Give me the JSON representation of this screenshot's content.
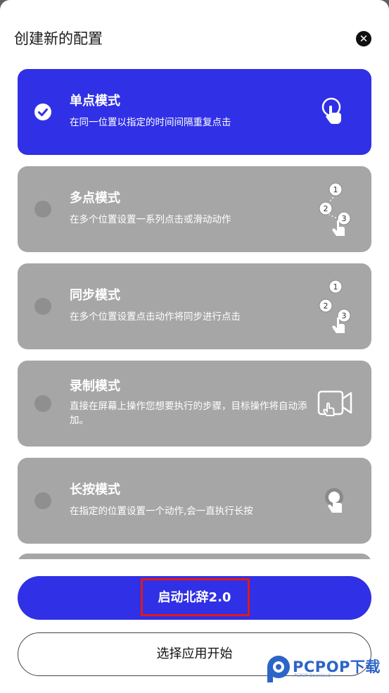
{
  "dialog": {
    "title": "创建新的配置",
    "close_icon": "close-icon"
  },
  "modes": [
    {
      "name": "单点模式",
      "description": "在同一位置以指定的时间间隔重复点击",
      "selected": true,
      "icon": "single-tap-icon"
    },
    {
      "name": "多点模式",
      "description": "在多个位置设置一系列点击或滑动动作",
      "selected": false,
      "icon": "multi-tap-icon",
      "steps": [
        "1",
        "2",
        "3"
      ]
    },
    {
      "name": "同步模式",
      "description": "在多个位置设置点击动作将同步进行点击",
      "selected": false,
      "icon": "sync-tap-icon",
      "steps": [
        "1",
        "2",
        "3"
      ]
    },
    {
      "name": "录制模式",
      "description": "直接在屏幕上操作您想要执行的步骤，目标操作将自动添加。",
      "selected": false,
      "icon": "record-video-icon"
    },
    {
      "name": "长按模式",
      "description": "在指定的位置设置一个动作,会一直执行长按",
      "selected": false,
      "icon": "long-press-icon"
    }
  ],
  "buttons": {
    "start_label": "启动北辞2.0",
    "choose_app_label": "选择应用开始"
  },
  "watermark": {
    "brand": "PCPOP下载",
    "sub": "PCPOP Download"
  },
  "colors": {
    "accent": "#3030e6",
    "card_inactive": "#a6a6a6",
    "highlight_box": "#e01a1a"
  }
}
